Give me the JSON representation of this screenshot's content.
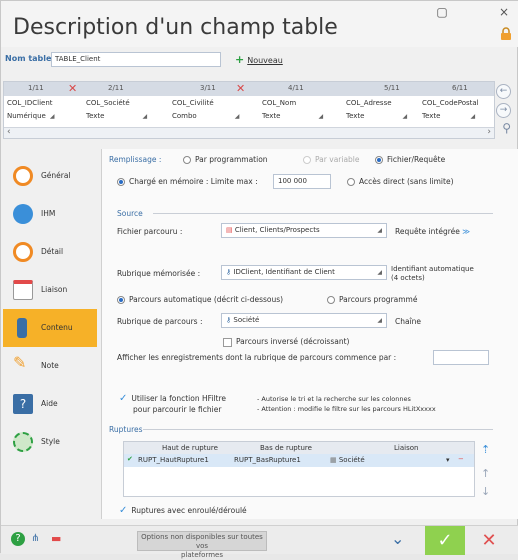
{
  "window": {
    "title": "Description d'un champ table",
    "minimize": "▢",
    "close": "×"
  },
  "table": {
    "label": "Nom table :",
    "value": "TABLE_Client",
    "new_label": "Nouveau"
  },
  "columns": [
    {
      "num": "1/11",
      "name": "COL_IDClient",
      "type": "Numérique"
    },
    {
      "num": "2/11",
      "name": "COL_Société",
      "type": "Texte"
    },
    {
      "num": "3/11",
      "name": "COL_Civilité",
      "type": "Combo"
    },
    {
      "num": "4/11",
      "name": "COL_Nom",
      "type": "Texte"
    },
    {
      "num": "5/11",
      "name": "COL_Adresse",
      "type": "Texte"
    },
    {
      "num": "6/11",
      "name": "COL_CodePostal",
      "type": "Texte"
    }
  ],
  "nav": [
    {
      "label": "Général",
      "color": "#f08a24"
    },
    {
      "label": "IHM",
      "color": "#3a8fd9"
    },
    {
      "label": "Détail",
      "color": "#f08a24"
    },
    {
      "label": "Liaison",
      "color": "#e24a4a"
    },
    {
      "label": "Contenu",
      "color": "#3a6ea5"
    },
    {
      "label": "Note",
      "color": "#f0a030"
    },
    {
      "label": "Aide",
      "color": "#3a6ea5"
    },
    {
      "label": "Style",
      "color": "#2ea043"
    }
  ],
  "contenu": {
    "remplissage_label": "Remplissage :",
    "par_programmation": "Par programmation",
    "par_variable": "Par variable",
    "fichier_requete": "Fichier/Requête",
    "charge_memoire": "Chargé en mémoire : Limite max :",
    "limite_value": "100 000",
    "acces_direct": "Accès direct (sans limite)",
    "source_label": "Source",
    "fichier_parcouru_label": "Fichier parcouru :",
    "fichier_parcouru_value": "Client, Clients/Prospects",
    "requete_integree": "Requête intégrée",
    "rubrique_memorisee_label": "Rubrique mémorisée :",
    "rubrique_memorisee_value": "IDClient, Identifiant de Client",
    "identifiant_auto": "Identifiant automatique",
    "identifiant_octets": "(4 octets)",
    "parcours_auto": "Parcours automatique (décrit ci-dessous)",
    "parcours_programme": "Parcours programmé",
    "rubrique_parcours_label": "Rubrique de parcours :",
    "rubrique_parcours_value": "Société",
    "chaine": "Chaîne",
    "parcours_inverse": "Parcours inversé (décroissant)",
    "afficher_label": "Afficher les enregistrements dont la rubrique de parcours commence par :",
    "hfiltre_line1": "Utiliser la fonction HFiltre",
    "hfiltre_line2": "pour parcourir le fichier",
    "hfiltre_note1": "- Autorise le tri et la recherche sur les colonnes",
    "hfiltre_note2": "- Attention : modifie le filtre sur les parcours HLitXxxxx",
    "ruptures_label": "Ruptures",
    "rupt_col_haut": "Haut de rupture",
    "rupt_col_bas": "Bas de rupture",
    "rupt_col_liaison": "Liaison",
    "rupt_row_haut": "RUPT_HautRupture1",
    "rupt_row_bas": "RUPT_BasRupture1",
    "rupt_row_liaison": "Société",
    "ruptures_enroule": "Ruptures avec enroulé/déroulé"
  },
  "bottom": {
    "options_line1": "Options non disponibles sur toutes vos",
    "options_line2": "plateformes"
  }
}
